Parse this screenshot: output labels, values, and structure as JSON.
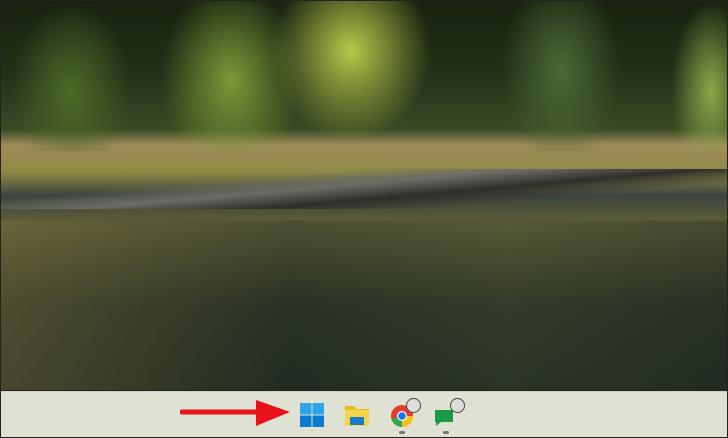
{
  "desktop": {
    "wallpaper": "forest-river-landscape"
  },
  "taskbar": {
    "items": [
      {
        "name": "start",
        "icon": "windows-logo-icon"
      },
      {
        "name": "file-explorer",
        "icon": "folder-icon"
      },
      {
        "name": "chrome",
        "icon": "chrome-icon",
        "running": true
      },
      {
        "name": "chat",
        "icon": "chat-icon",
        "running": true
      }
    ]
  },
  "annotation": {
    "color": "#e8131a",
    "points_to": "start"
  }
}
